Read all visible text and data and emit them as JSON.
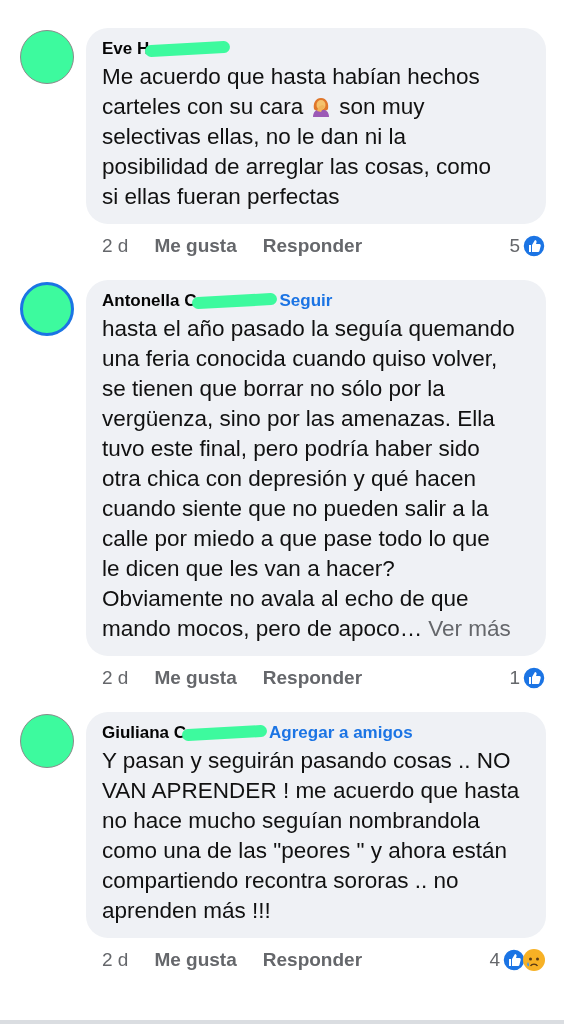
{
  "comments": [
    {
      "author": "Eve H",
      "story_ring": false,
      "lines": [
        [
          "Me acuerdo que hasta habían hechos"
        ],
        [
          "carteles con su cara",
          "son muy"
        ],
        [
          "selectivas ellas, no le dan ni la"
        ],
        [
          "posibilidad de arreglar las cosas, como"
        ],
        [
          "si ellas fueran perfectas"
        ]
      ],
      "time": "2 d",
      "like": "Me gusta",
      "reply": "Responder",
      "count": "5",
      "reactions": {
        "like": true
      }
    },
    {
      "author": "Antonella C",
      "story_ring": true,
      "action_link": "Seguir",
      "lines": [
        [
          "hasta el año pasado la seguía quemando"
        ],
        [
          "una feria conocida cuando quiso volver,"
        ],
        [
          "se tienen que borrar no sólo por la"
        ],
        [
          "vergüenza, sino por las amenazas. Ella"
        ],
        [
          "tuvo este final, pero podría haber sido"
        ],
        [
          "otra chica con depresión y qué hacen"
        ],
        [
          "cuando siente que no pueden salir a la"
        ],
        [
          "calle por miedo a que pase todo lo que"
        ],
        [
          "le dicen que les van a hacer?"
        ],
        [
          "Obviamente no avala al echo de que"
        ],
        [
          "mando mocos, pero de apoco…"
        ]
      ],
      "more": "Ver más",
      "time": "2 d",
      "like": "Me gusta",
      "reply": "Responder",
      "count": "1",
      "reactions": {
        "like": true
      }
    },
    {
      "author": "Giuliana C",
      "story_ring": false,
      "action_link": "Agregar a amigos",
      "lines": [
        [
          "Y pasan y seguirán pasando cosas .. NO"
        ],
        [
          "VAN APRENDER ! me acuerdo que hasta"
        ],
        [
          "no hace mucho seguían nombrandola"
        ],
        [
          "como una de las \"peores \" y ahora están"
        ],
        [
          "compartiendo recontra sororas .. no"
        ],
        [
          "aprenden más !!!"
        ]
      ],
      "time": "2 d",
      "like": "Me gusta",
      "reply": "Responder",
      "count": "4",
      "reactions": {
        "like": true,
        "sad": true
      }
    }
  ]
}
